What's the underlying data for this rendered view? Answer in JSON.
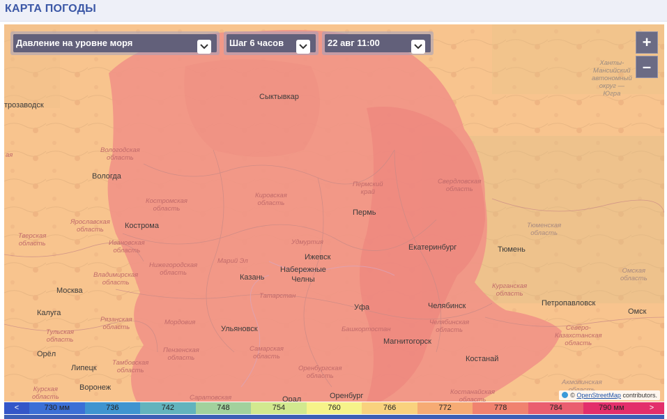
{
  "header": {
    "title": "КАРТА ПОГОДЫ"
  },
  "controls": {
    "parameter": "Давление на уровне моря",
    "step": "Шаг 6 часов",
    "datetime": "22 авг 11:00"
  },
  "zoom": {
    "in": "+",
    "out": "–"
  },
  "cities": {
    "petrozavodsk": "трозаводск",
    "syktyvkar": "Сыктывкар",
    "vologda": "Вологда",
    "kostroma": "Кострома",
    "perm": "Пермь",
    "ekaterinburg": "Екатеринбург",
    "tyumen": "Тюмень",
    "izhevsk": "Ижевск",
    "naberezhnye": "Набережные\nЧелны",
    "kazan": "Казань",
    "moskva": "Москва",
    "kaluga": "Калуга",
    "ufa": "Уфа",
    "chelyabinsk": "Челябинск",
    "petropavlovsk": "Петропавловск",
    "omsk": "Омск",
    "ulyanovsk": "Ульяновск",
    "magnitogorsk": "Магнитогорск",
    "kostanay": "Костанай",
    "orel": "Орёл",
    "lipetsk": "Липецк",
    "voronezh": "Воронеж",
    "orenburg": "Оренбург",
    "orsk_part": "Орал"
  },
  "regions": {
    "khanty": "Ханты-\nМансийский\nавтономный\nокруг —\nЮгра",
    "vologodskaya": "Вологодская\nобласть",
    "kostromskaya": "Костромская\nобласть",
    "kirovskaya": "Кировская\nобласть",
    "permsky": "Пермский\nкрай",
    "sverdlovskaya": "Свердловская\nобласть",
    "yaroslavskaya": "Ярославская\nобласть",
    "tverskaya": "Тверская\nобласть",
    "ivanovskaya": "Ивановская\nобласть",
    "udmurtia": "Удмуртия",
    "tyumenskaya": "Тюменская\nобласть",
    "mariy_el": "Марий Эл",
    "nizhegorodskaya": "Нижегородская\nобласть",
    "vladimirskaya": "Владимирская\nобласть",
    "tatarstan": "Татарстан",
    "kurganskaya": "Курганская\nобласть",
    "omskaya": "Омская\nобласть",
    "ryazanskaya": "Рязанская\nобласть",
    "tulskaya": "Тульская\nобласть",
    "mordovia": "Мордовия",
    "bashkortostan": "Башкортостан",
    "chelyabinskaya": "Челябинская\nобласть",
    "severo_kaz": "Северо-\nКазахстанская\nобласть",
    "penzenskaya": "Пензенская\nобласть",
    "samarskaya": "Самарская\nобласть",
    "tambovskaya": "Тамбовская\nобласть",
    "orenburgskaya": "Оренбургская\nобласть",
    "kurskaya": "Курская\nобласть",
    "saratovskaya": "Саратовская",
    "kostanayskaya": "Костанайская\nобласть",
    "akmolinskaya": "Акмолинская\nобласть",
    "left_edge": "ая"
  },
  "attribution": {
    "prefix": "©",
    "link": "OpenStreetMap",
    "suffix": "contributors."
  },
  "legend": {
    "left_arrow": "<",
    "right_arrow": ">",
    "items": [
      {
        "label": "730 мм",
        "color": "#3b6fd6"
      },
      {
        "label": "736",
        "color": "#3f94d0"
      },
      {
        "label": "742",
        "color": "#62b3bd"
      },
      {
        "label": "748",
        "color": "#a2d19d"
      },
      {
        "label": "754",
        "color": "#d2e98f"
      },
      {
        "label": "760",
        "color": "#f6f38a"
      },
      {
        "label": "766",
        "color": "#f9d27e"
      },
      {
        "label": "772",
        "color": "#f6ab74"
      },
      {
        "label": "778",
        "color": "#f0826f"
      },
      {
        "label": "784",
        "color": "#ea5e6f"
      },
      {
        "label": "790 мм",
        "color": "#e32f6b"
      }
    ]
  }
}
